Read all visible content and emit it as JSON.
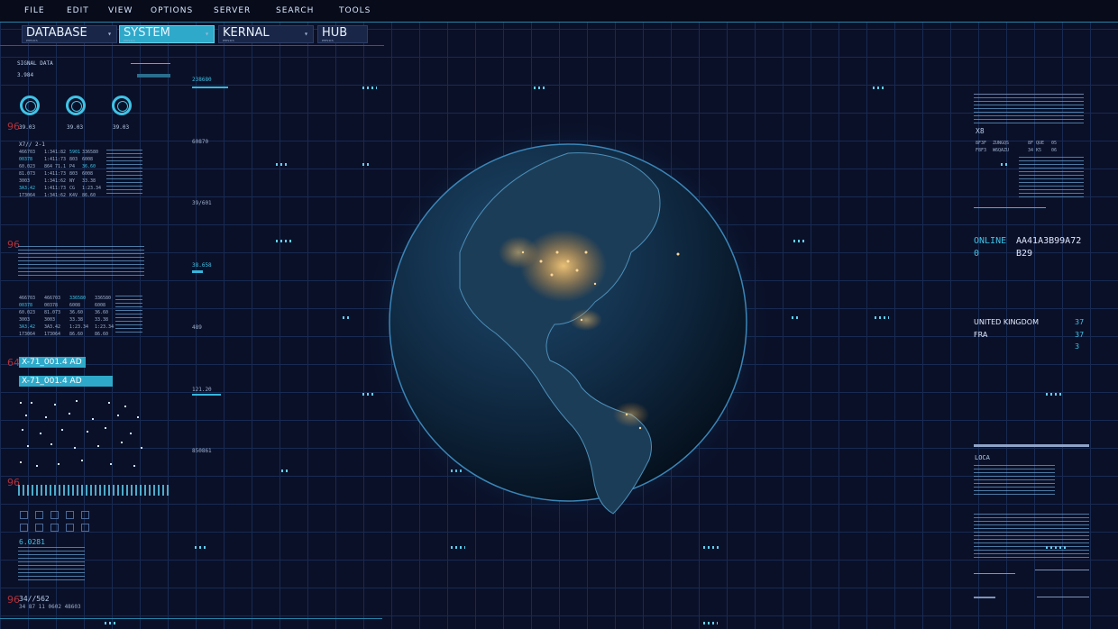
{
  "menu": [
    "FILE",
    "EDIT",
    "VIEW",
    "OPTIONS",
    "SERVER",
    "SEARCH",
    "TOOLS"
  ],
  "tabs": [
    {
      "label": "DATABASE",
      "sub": "PHYSICS",
      "active": false
    },
    {
      "label": "SYSTEM",
      "sub": "PHYSICS",
      "active": true
    },
    {
      "label": "KERNAL",
      "sub": "PHYSICS",
      "active": false
    },
    {
      "label": "HUB",
      "sub": "PHYSICS",
      "active": false
    }
  ],
  "left": {
    "signal_title": "SIGNAL DATA",
    "signal_value": "3.984",
    "rings": [
      "39.03",
      "39.03",
      "39.03"
    ],
    "red_markers": [
      "96",
      "96",
      "64",
      "96",
      "96"
    ],
    "table_title": "X7// 2-1",
    "table_rows": [
      [
        "466703",
        "1:34",
        "1:82",
        "5901",
        "336580"
      ],
      [
        "00378",
        "1:41",
        "1:73",
        "803",
        "6008"
      ],
      [
        "60.023",
        "864",
        "71.1",
        "P4",
        "36.60"
      ],
      [
        "81.073",
        "1:41",
        "1:73",
        "803",
        "6008"
      ],
      [
        "3003",
        "1:34",
        "1:62",
        "NY",
        "33.38"
      ],
      [
        "3A3.42",
        "1:41",
        "1:73",
        "CG",
        "1:23.34"
      ],
      [
        "173064",
        "1:34",
        "1:62",
        "K4V",
        "86.60"
      ]
    ],
    "tag_1": "X-71_001.4 AD",
    "tag_2": "X-71_001.4 AD",
    "code_small": "6.0281",
    "bottom_code": "34//562",
    "bottom_code_sub": "34 87 11 0602 48603"
  },
  "scale": [
    "238680",
    "60870",
    "39/601",
    "38.658",
    "489",
    "121.20",
    "850861"
  ],
  "right": {
    "panel_label": "X8",
    "panel_codes": [
      "8F3F",
      "ZUNGQS",
      "8F QUE",
      "05",
      "F8F3",
      "W6QAZU",
      "34 K5",
      "06"
    ],
    "status": "ONLINE",
    "status_value": "0",
    "code_line_1": "AA41A3B99A72",
    "code_line_2": "B29",
    "countries": [
      {
        "name": "UNITED KINGDOM",
        "value": "37"
      },
      {
        "name": "FRA",
        "value": "37"
      },
      {
        "name": "",
        "value": "3"
      }
    ],
    "loca": "LOCA"
  },
  "colors": {
    "accent": "#2fa9c9",
    "background": "#0a1028",
    "grid": "#1b2f5a",
    "alert": "#b3303a"
  }
}
